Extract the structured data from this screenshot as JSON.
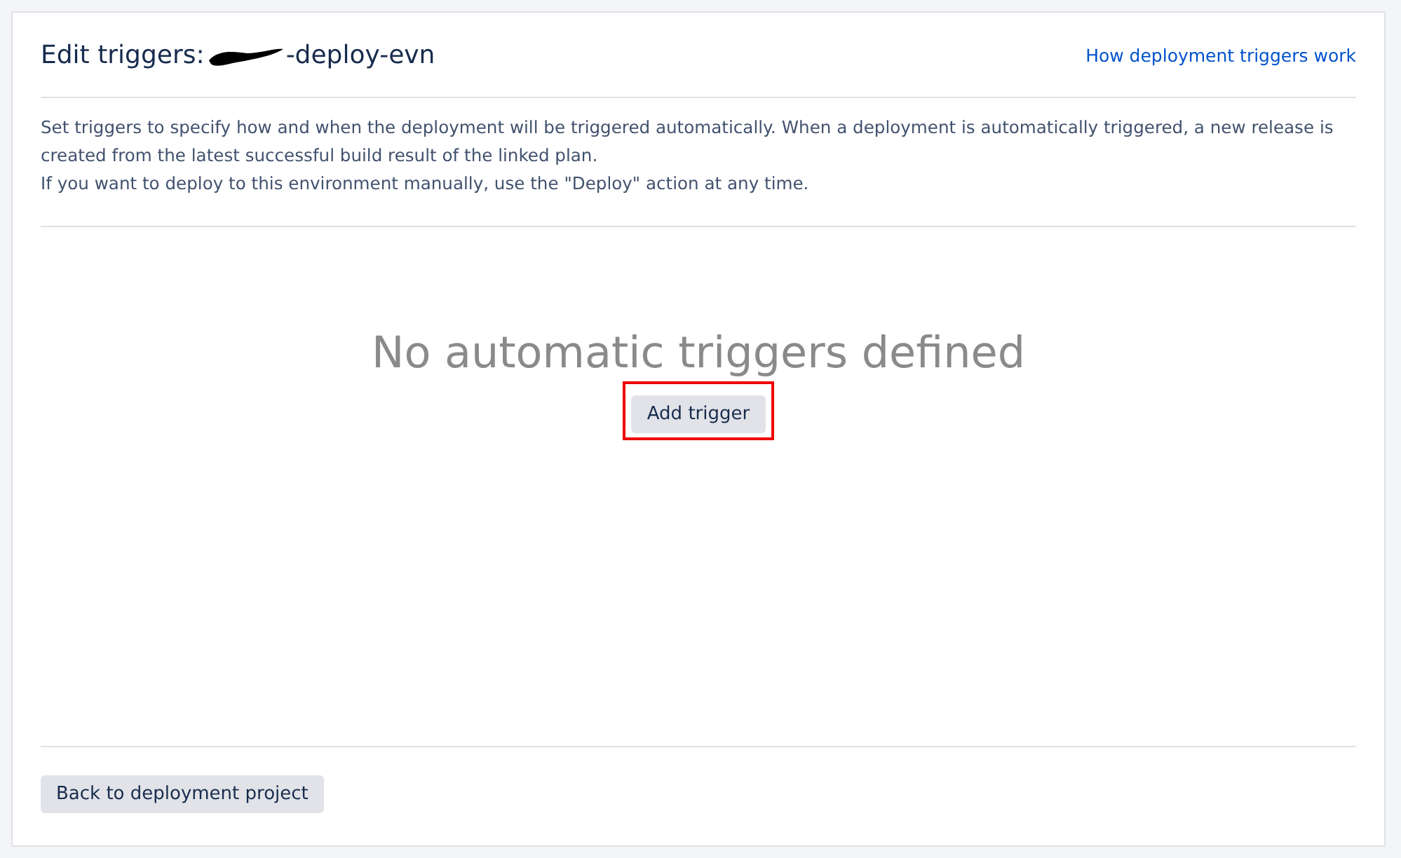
{
  "header": {
    "title": "Edit triggers:",
    "title_suffix": "-deploy-evn",
    "redacted": true,
    "help_link": "How deployment triggers work"
  },
  "description": [
    "Set triggers to specify how and when the deployment will be triggered automatically. When a deployment is automatically triggered, a new release is created from the latest successful build result of the linked plan.",
    "If you want to deploy to this environment manually, use the \"Deploy\" action at any time."
  ],
  "empty_state": {
    "message": "No automatic triggers defined",
    "button": "Add trigger",
    "highlighted": true
  },
  "footer": {
    "button": "Back to deployment project"
  }
}
